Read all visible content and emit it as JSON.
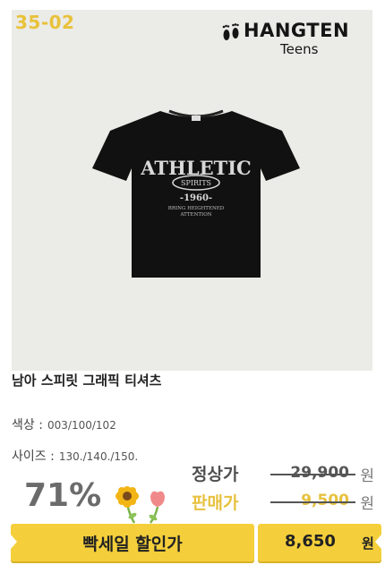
{
  "item_code": "35-02",
  "brand": {
    "name": "HANGTEN",
    "sub": "Teens"
  },
  "product": {
    "title": "남아 스피릿 그래픽 티셔츠",
    "shirt_print": {
      "line1": "ATHLETIC",
      "line2": "SPIRITS",
      "line3": "-1960-",
      "line4": "BRING HEIGHTENED",
      "line5": "ATTENTION"
    }
  },
  "specs": {
    "color_label": "색상 :",
    "color_value": "003/100/102",
    "size_label": "사이즈 :",
    "size_value": "130./140./150."
  },
  "pricing": {
    "discount_rate": "71%",
    "regular_label": "정상가",
    "regular_price": "29,900",
    "sale_label": "판매가",
    "sale_price": "9,500",
    "currency_unit": "원",
    "banner_text": "빡세일 할인가",
    "final_price": "8,650",
    "final_unit": "원"
  },
  "colors": {
    "accent_yellow": "#f4cf3b",
    "sale_text_yellow": "#e7c13e",
    "shirt_black": "#111111",
    "background_gray": "#ebebe7"
  }
}
